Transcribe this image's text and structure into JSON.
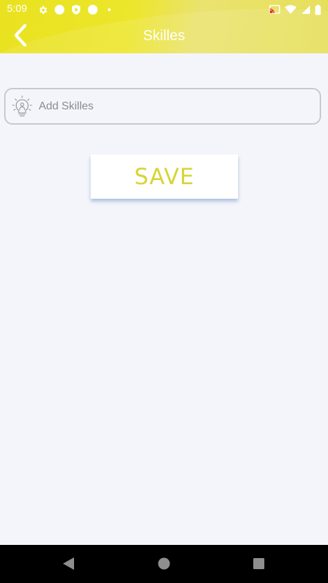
{
  "status_bar": {
    "time": "5:09",
    "left_icons": [
      "gear-icon",
      "circle-icon",
      "play-shield-icon",
      "circle-icon",
      "dot-icon"
    ],
    "right_icons": [
      "cast-icon",
      "wifi-icon",
      "signal-icon",
      "battery-icon"
    ]
  },
  "header": {
    "title": "Skilles",
    "back_icon": "chevron-left-icon"
  },
  "form": {
    "skill_field": {
      "icon": "lightbulb-person-icon",
      "placeholder": "Add Skilles",
      "value": ""
    },
    "save_label": "SAVE"
  },
  "nav_bar": {
    "buttons": [
      "back-triangle-icon",
      "home-circle-icon",
      "recents-square-icon"
    ]
  },
  "colors": {
    "header_yellow": "#ece62c",
    "save_text": "#d8d434",
    "background": "#f4f5fa",
    "field_border": "#c7c7cc"
  }
}
